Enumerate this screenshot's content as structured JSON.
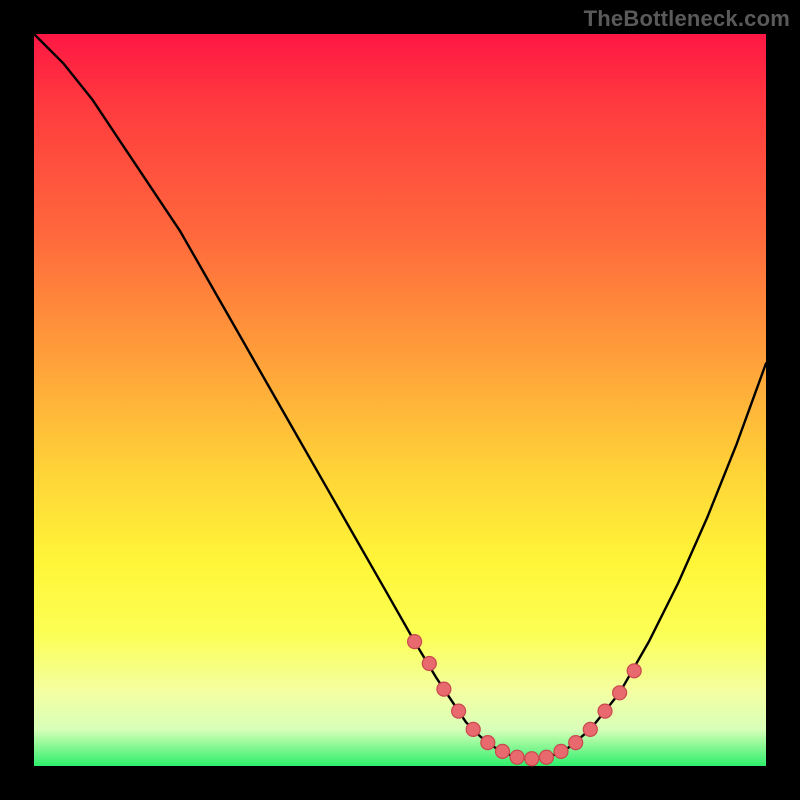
{
  "watermark": "TheBottleneck.com",
  "chart_data": {
    "type": "line",
    "title": "",
    "xlabel": "",
    "ylabel": "",
    "xlim": [
      0,
      100
    ],
    "ylim": [
      0,
      100
    ],
    "grid": false,
    "legend": false,
    "series": [
      {
        "name": "bottleneck-curve",
        "x": [
          0,
          4,
          8,
          12,
          16,
          20,
          24,
          28,
          32,
          36,
          40,
          44,
          48,
          52,
          55,
          57,
          59,
          61,
          63,
          65,
          67,
          69,
          71,
          73,
          76,
          80,
          84,
          88,
          92,
          96,
          100
        ],
        "y": [
          100,
          96,
          91,
          85,
          79,
          73,
          66,
          59,
          52,
          45,
          38,
          31,
          24,
          17,
          12,
          9,
          6,
          4,
          2.5,
          1.5,
          1,
          1,
          1.5,
          2.5,
          5,
          10,
          17,
          25,
          34,
          44,
          55
        ]
      }
    ],
    "markers": {
      "name": "highlight-dots",
      "x": [
        52,
        54,
        56,
        58,
        60,
        62,
        64,
        66,
        68,
        70,
        72,
        74,
        76,
        78,
        80,
        82
      ],
      "y": [
        17,
        14,
        10.5,
        7.5,
        5,
        3.2,
        2,
        1.2,
        1,
        1.2,
        2,
        3.2,
        5,
        7.5,
        10,
        13
      ]
    },
    "colors": {
      "gradient_top": "#ff1744",
      "gradient_mid": "#fff538",
      "gradient_bottom": "#2eef6b",
      "curve": "#000000",
      "dots_fill": "#e86a6e",
      "dots_stroke": "#c8484e",
      "background": "#000000"
    }
  }
}
